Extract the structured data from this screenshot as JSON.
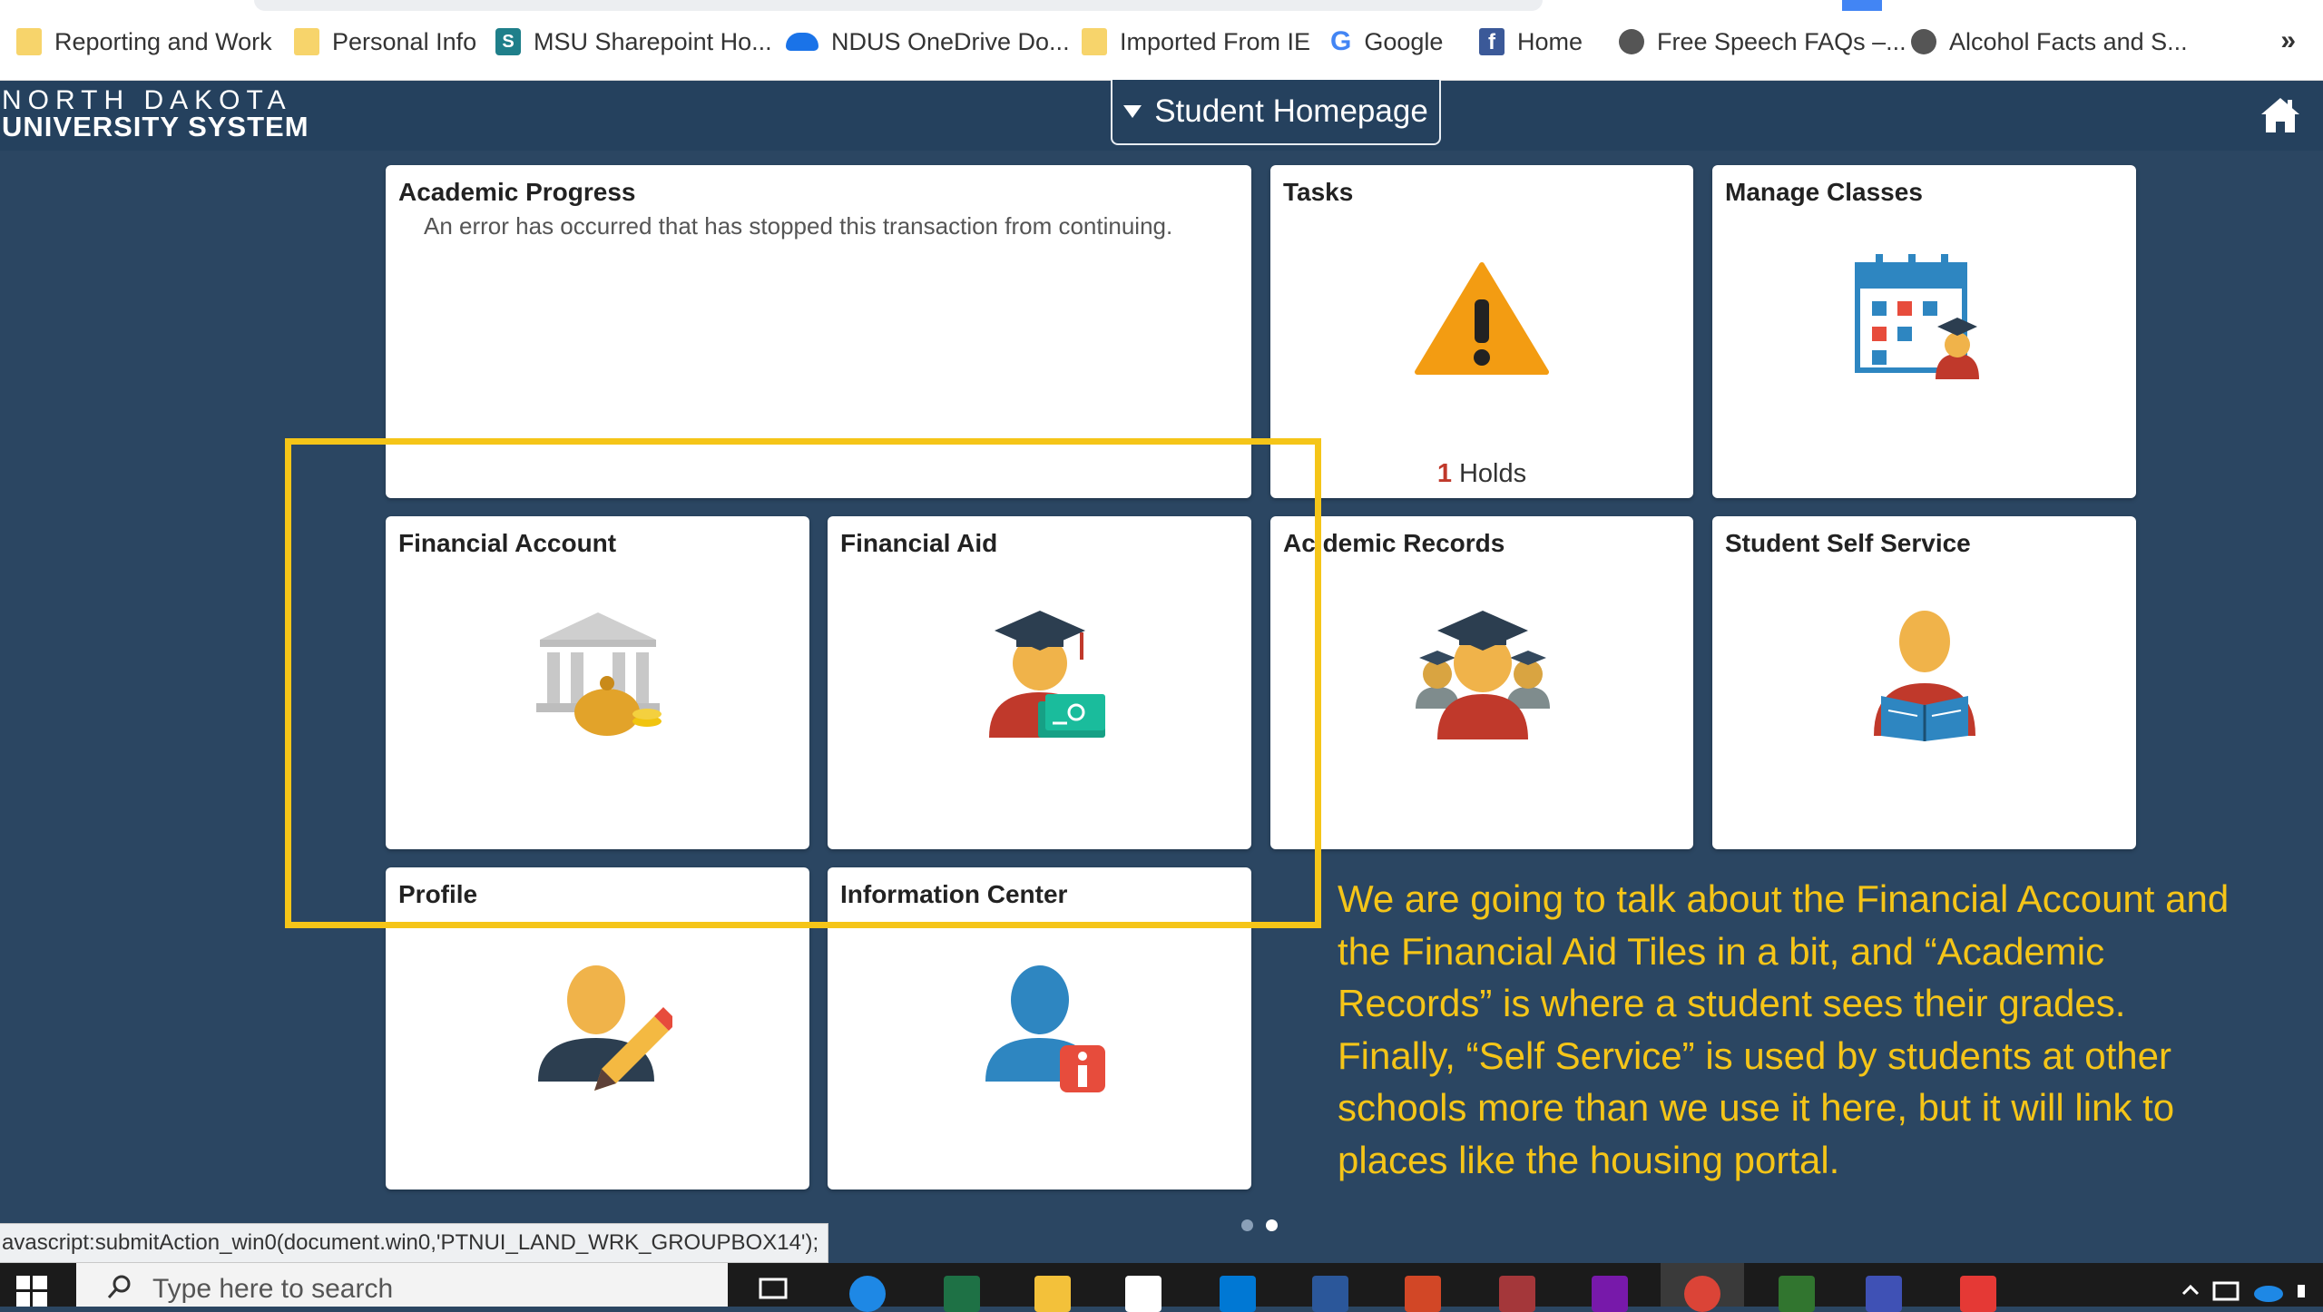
{
  "bookmarks": {
    "items": [
      {
        "label": "Reporting and Work",
        "icon": "folder-icon"
      },
      {
        "label": "Personal Info",
        "icon": "folder-icon"
      },
      {
        "label": "MSU Sharepoint Ho...",
        "icon": "sharepoint-icon"
      },
      {
        "label": "NDUS OneDrive Do...",
        "icon": "onedrive-icon"
      },
      {
        "label": "Imported From IE",
        "icon": "folder-icon"
      },
      {
        "label": "Google",
        "icon": "google-icon"
      },
      {
        "label": "Home",
        "icon": "facebook-icon"
      },
      {
        "label": "Free Speech FAQs –...",
        "icon": "globe-icon"
      },
      {
        "label": "Alcohol Facts and S...",
        "icon": "globe-icon"
      }
    ],
    "more": "»",
    "sharepoint_glyph": "S",
    "google_glyph": "G",
    "facebook_glyph": "f"
  },
  "header": {
    "logo_line1": "NORTH DAKOTA",
    "logo_line2": "UNIVERSITY SYSTEM",
    "homepage_label": "Student Homepage"
  },
  "tiles": {
    "academic_progress": {
      "title": "Academic Progress",
      "message": "An error has occurred that has stopped this transaction from continuing."
    },
    "tasks": {
      "title": "Tasks",
      "holds_count": "1",
      "holds_label": "Holds"
    },
    "manage_classes": {
      "title": "Manage Classes"
    },
    "financial_account": {
      "title": "Financial Account"
    },
    "financial_aid": {
      "title": "Financial Aid"
    },
    "academic_records": {
      "title": "Ac demic Records"
    },
    "student_self_service": {
      "title": "Student Self Service"
    },
    "profile": {
      "title": "Profile"
    },
    "information_center": {
      "title": "Information Center"
    }
  },
  "annotation": "We are going to talk about the Financial Account and the Financial Aid Tiles in a bit, and “Academic Records” is where a student sees their grades. Finally, “Self Service” is used by students at other schools more than we use it here, but it will link to places like the housing portal.",
  "status_bar": "avascript:submitAction_win0(document.win0,'PTNUI_LAND_WRK_GROUPBOX14');",
  "taskbar": {
    "search_placeholder": "Type here to search"
  },
  "colors": {
    "background": "#2b4662",
    "header": "#25415e",
    "highlight": "#f5c518",
    "annotation_text": "#f5c518",
    "holds_count": "#c0392b"
  }
}
